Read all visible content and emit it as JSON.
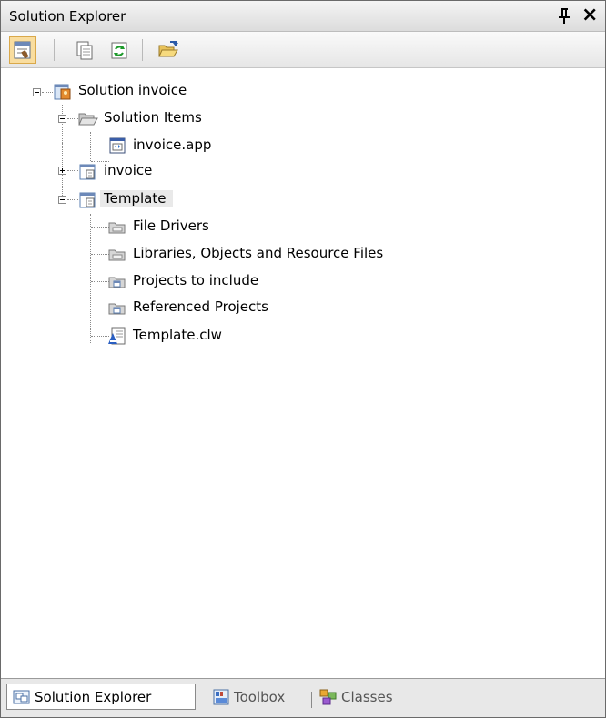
{
  "window": {
    "title": "Solution Explorer"
  },
  "toolbar": {
    "buttons": [
      {
        "icon": "properties-icon"
      },
      {
        "icon": "show-all-files-icon"
      },
      {
        "icon": "refresh-icon"
      },
      {
        "icon": "open-folder-icon"
      }
    ]
  },
  "tree": {
    "solution": "Solution invoice",
    "solution_items": "Solution Items",
    "invoice_app": "invoice.app",
    "invoice_project": "invoice",
    "template_project": "Template",
    "file_drivers": "File Drivers",
    "libraries": "Libraries, Objects and Resource Files",
    "projects_to_include": "Projects to include",
    "referenced_projects": "Referenced Projects",
    "template_clw": "Template.clw"
  },
  "tabs": [
    {
      "label": "Solution Explorer",
      "active": true
    },
    {
      "label": "Toolbox",
      "active": false
    },
    {
      "label": "Classes",
      "active": false
    }
  ],
  "colors": {
    "selected_tab_bg": "#ffffff",
    "pressed_button": "#f9dd9f",
    "selected_node_bg": "#e9e9e9"
  }
}
